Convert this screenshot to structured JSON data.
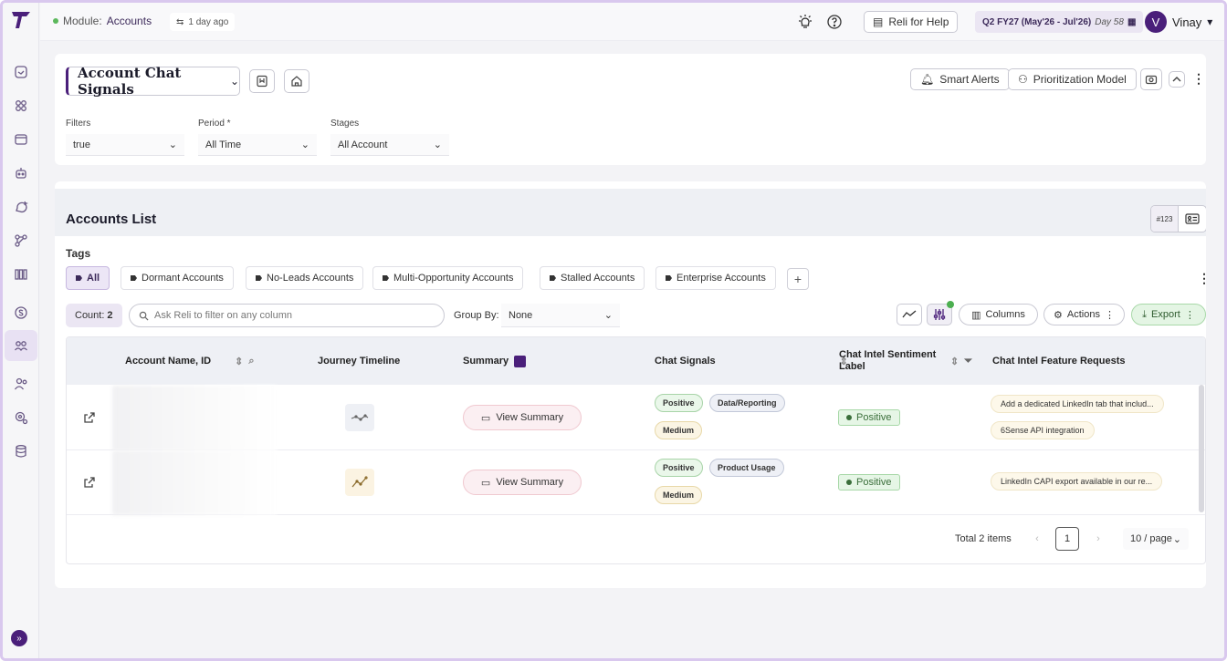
{
  "topbar": {
    "module_label": "Module:",
    "module_value": "Accounts",
    "updated": "1 day ago",
    "help_label": "Reli for Help",
    "quarter": "Q2 FY27 (May'26 - Jul'26)",
    "day": "Day 58",
    "user_initial": "V",
    "user_name": "Vinay"
  },
  "header": {
    "title": "Account Chat Signals",
    "smart_alerts": "Smart Alerts",
    "prioritization": "Prioritization Model"
  },
  "filters": {
    "filters_label": "Filters",
    "filters_value": "true",
    "period_label": "Period *",
    "period_value": "All Time",
    "stages_label": "Stages",
    "stages_value": "All Account"
  },
  "list": {
    "title": "Accounts List",
    "view_toggle_label": "#123",
    "tags_label": "Tags",
    "tags": [
      "All",
      "Dormant Accounts",
      "No-Leads Accounts",
      "Multi-Opportunity Accounts",
      "Stalled Accounts",
      "Enterprise Accounts"
    ],
    "tag_add": "+",
    "count_label": "Count:",
    "count_value": "2",
    "search_placeholder": "Ask Reli to filter on any column",
    "group_by_label": "Group By:",
    "group_by_value": "None",
    "columns_label": "Columns",
    "actions_label": "Actions",
    "export_label": "Export"
  },
  "table": {
    "headers": [
      "Account Name, ID",
      "Journey Timeline",
      "Summary",
      "Chat Signals",
      "Chat Intel Sentiment Label",
      "Chat Intel Feature Requests"
    ],
    "rows": [
      {
        "summary_btn": "View Summary",
        "signals": [
          "Positive",
          "Data/Reporting",
          "Medium"
        ],
        "sentiment": "Positive",
        "feature_requests": [
          "Add a dedicated LinkedIn tab that includ...",
          "6Sense API integration"
        ]
      },
      {
        "summary_btn": "View Summary",
        "signals": [
          "Positive",
          "Product Usage",
          "Medium"
        ],
        "sentiment": "Positive",
        "feature_requests": [
          "LinkedIn CAPI export available in our re..."
        ]
      }
    ]
  },
  "pagination": {
    "total": "Total 2 items",
    "current_page": "1",
    "page_size": "10 / page",
    "prev": "‹",
    "next": "›"
  },
  "colors": {
    "brand": "#4a1f7a",
    "positive": "#3a6e3a",
    "accent_bg": "#ebe6f3"
  }
}
